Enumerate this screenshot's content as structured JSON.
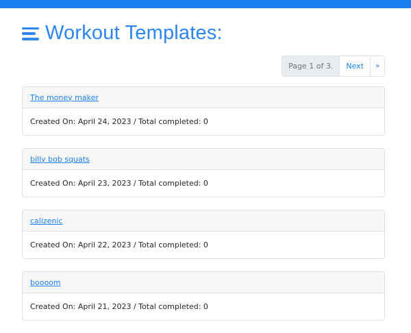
{
  "header": {
    "title": "Workout Templates:",
    "icon": "menu-icon",
    "accent_color": "#2d85ee",
    "topbar_color": "#1a7ff0"
  },
  "pagination": {
    "current": "Page 1 of 3.",
    "next_label": "Next",
    "last_label": "»"
  },
  "templates": [
    {
      "name": "The money maker",
      "meta": "Created On: April 24, 2023 / Total completed: 0"
    },
    {
      "name": "billy bob squats",
      "meta": "Created On: April 23, 2023 / Total completed: 0"
    },
    {
      "name": "calizenic",
      "meta": "Created On: April 22, 2023 / Total completed: 0"
    },
    {
      "name": "boooom",
      "meta": "Created On: April 21, 2023 / Total completed: 0"
    }
  ]
}
